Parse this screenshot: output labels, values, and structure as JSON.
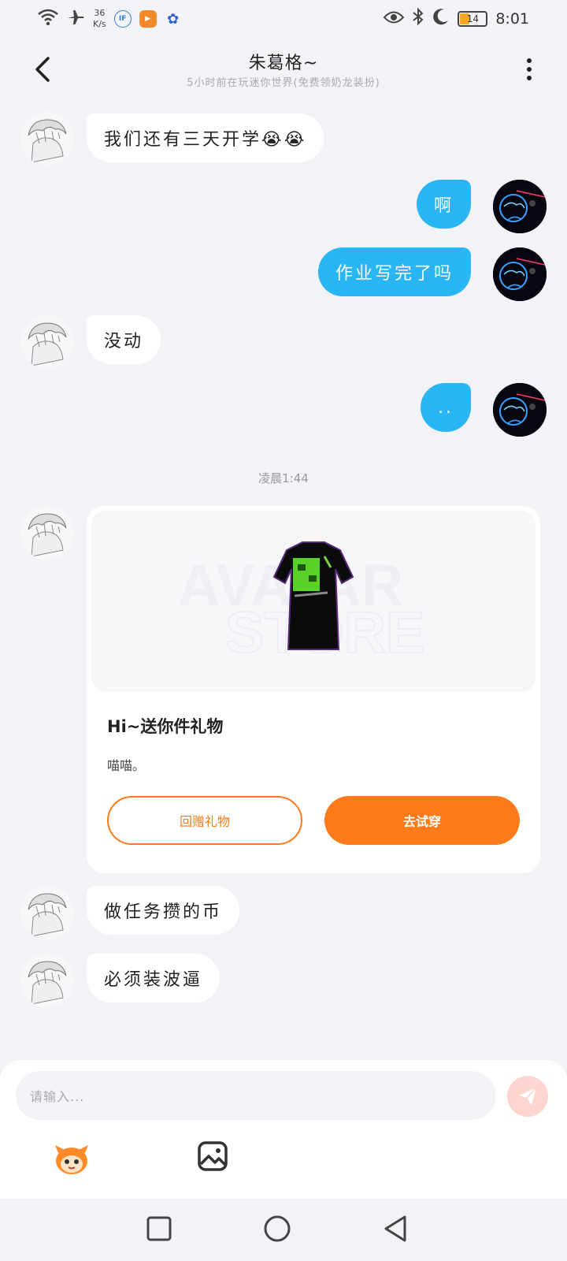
{
  "status_bar": {
    "net_speed_value": "36",
    "net_speed_unit": "K/s",
    "battery": "14",
    "time": "8:01"
  },
  "header": {
    "title": "朱葛格~",
    "subtitle": "5小时前在玩迷你世界(免费领奶龙装扮)"
  },
  "messages": [
    {
      "side": "in",
      "text": "我们还有三天开学😭😭"
    },
    {
      "side": "out",
      "text": "啊"
    },
    {
      "side": "out",
      "text": "作业写完了吗"
    },
    {
      "side": "in",
      "text": "没动"
    },
    {
      "side": "out",
      "text": ".."
    },
    {
      "side": "in",
      "text": "做任务攒的币"
    },
    {
      "side": "in",
      "text": "必须装波逼"
    }
  ],
  "timestamp": "凌晨1:44",
  "gift_card": {
    "watermark_line1": "AVATAR",
    "watermark_line2": "STORE",
    "title": "Hi~送你件礼物",
    "description": "喵喵。",
    "return_gift_label": "回赠礼物",
    "try_on_label": "去试穿"
  },
  "input": {
    "placeholder": "请输入..."
  },
  "colors": {
    "accent_blue": "#2ab5f5",
    "accent_orange": "#ff7a1a",
    "background": "#f2f3f6"
  },
  "icons": [
    "wifi-icon",
    "airplane-icon",
    "eye-icon",
    "bluetooth-icon",
    "moon-icon",
    "back-icon",
    "more-icon",
    "send-icon",
    "mascot-icon",
    "image-icon",
    "square-nav-icon",
    "circle-nav-icon",
    "back-nav-icon"
  ]
}
